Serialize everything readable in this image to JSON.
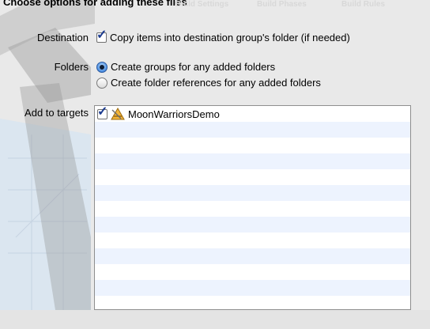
{
  "dialog": {
    "title": "Choose options for adding these files",
    "bg_tabs": [
      "Build Settings",
      "Build Phases",
      "Build Rules"
    ]
  },
  "destination": {
    "label": "Destination",
    "copy_items_label": "Copy items into destination group's folder (if needed)",
    "copy_items_checked": true
  },
  "folders": {
    "label": "Folders",
    "options": [
      {
        "label": "Create groups for any added folders",
        "selected": true
      },
      {
        "label": "Create folder references for any added folders",
        "selected": false
      }
    ]
  },
  "targets": {
    "label": "Add to targets",
    "items": [
      {
        "name": "MoonWarriorsDemo",
        "checked": true,
        "icon": "app-target-icon"
      }
    ]
  },
  "colors": {
    "accent": "#2a62b8",
    "row_stripe": "#edf3fe"
  }
}
